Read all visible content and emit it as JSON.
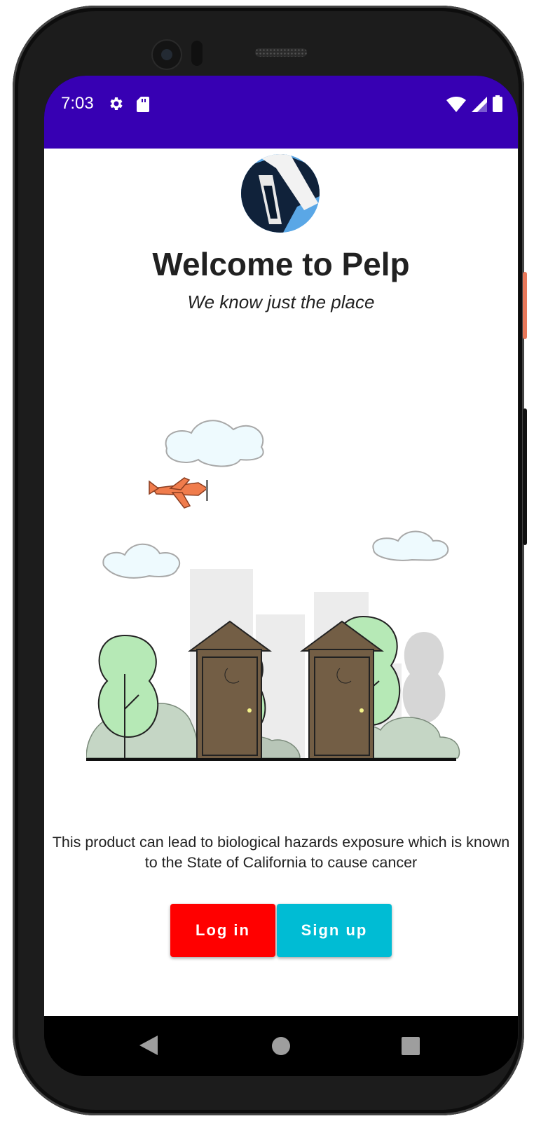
{
  "status_bar": {
    "time": "7:03",
    "icons": [
      "gear-icon",
      "sd-card-icon",
      "wifi-icon",
      "signal-icon",
      "battery-icon"
    ],
    "background": "#3700b3"
  },
  "welcome": {
    "title": "Welcome to Pelp",
    "subtitle": "We know just the place",
    "warning": "This product can lead to biological hazards exposure which is known to the State of California to cause cancer"
  },
  "buttons": {
    "login_label": "Log in",
    "signup_label": "Sign up",
    "login_color": "#ff0000",
    "signup_color": "#00bcd4"
  },
  "nav_bar": {
    "icons": [
      "back-icon",
      "home-icon",
      "recents-icon"
    ]
  }
}
